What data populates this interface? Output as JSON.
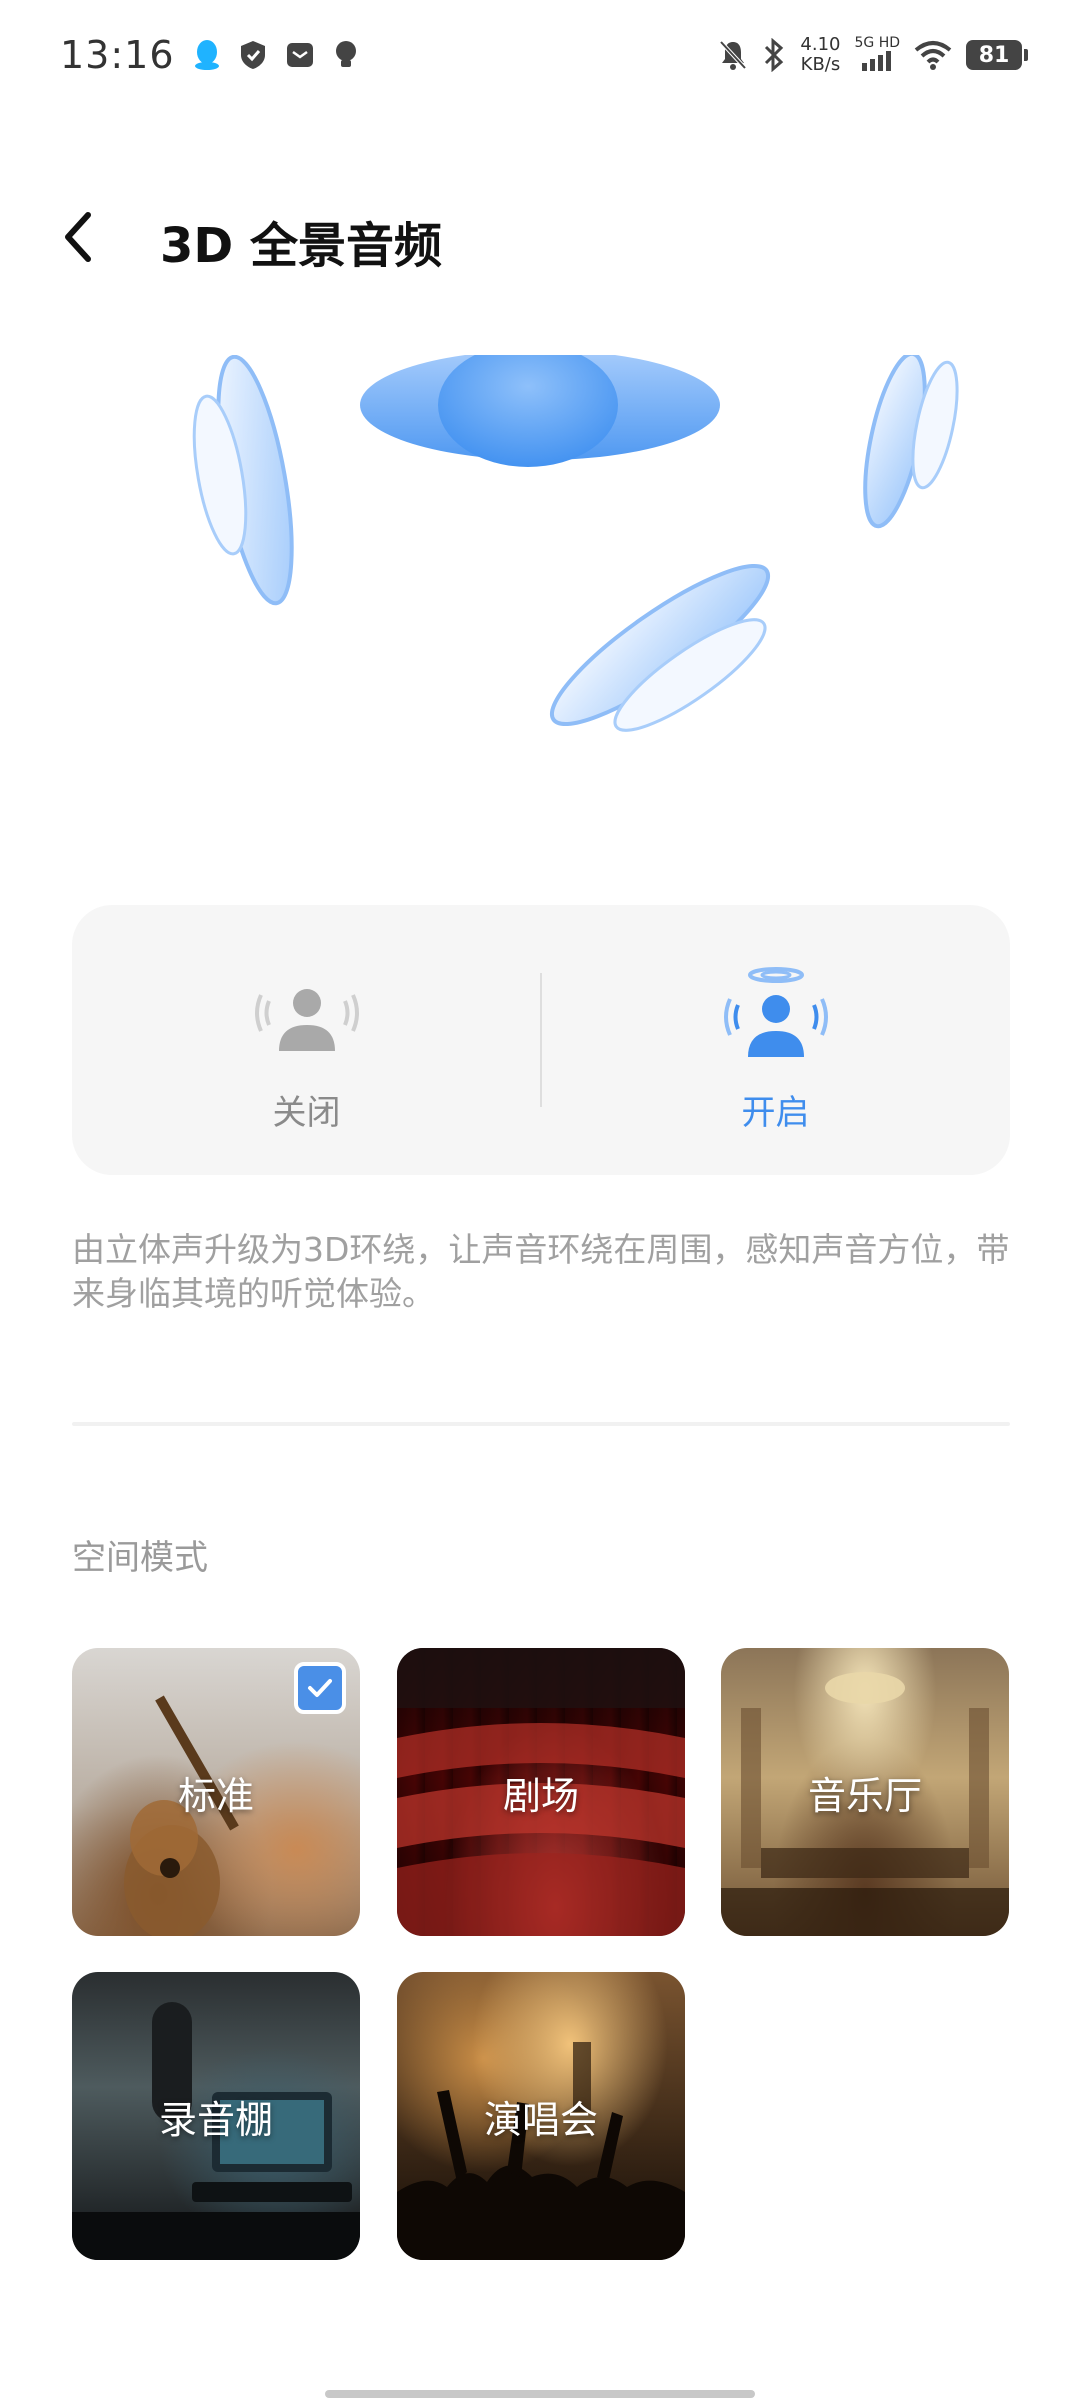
{
  "status_bar": {
    "time": "13:16",
    "net_speed_value": "4.10",
    "net_speed_unit": "KB/s",
    "network_label": "5G HD",
    "battery": "81"
  },
  "header": {
    "title": "3D 全景音频"
  },
  "mode_toggle": {
    "off_label": "关闭",
    "on_label": "开启",
    "selected": "on"
  },
  "description": "由立体声升级为3D环绕，让声音环绕在周围，感知声音方位，带来身临其境的听觉体验。",
  "spatial_mode": {
    "section_title": "空间模式",
    "items": [
      {
        "label": "标准",
        "selected": true
      },
      {
        "label": "剧场",
        "selected": false
      },
      {
        "label": "音乐厅",
        "selected": false
      },
      {
        "label": "录音棚",
        "selected": false
      },
      {
        "label": "演唱会",
        "selected": false
      }
    ]
  },
  "colors": {
    "accent": "#4a8fe7",
    "inactive": "#a9a9a9"
  }
}
